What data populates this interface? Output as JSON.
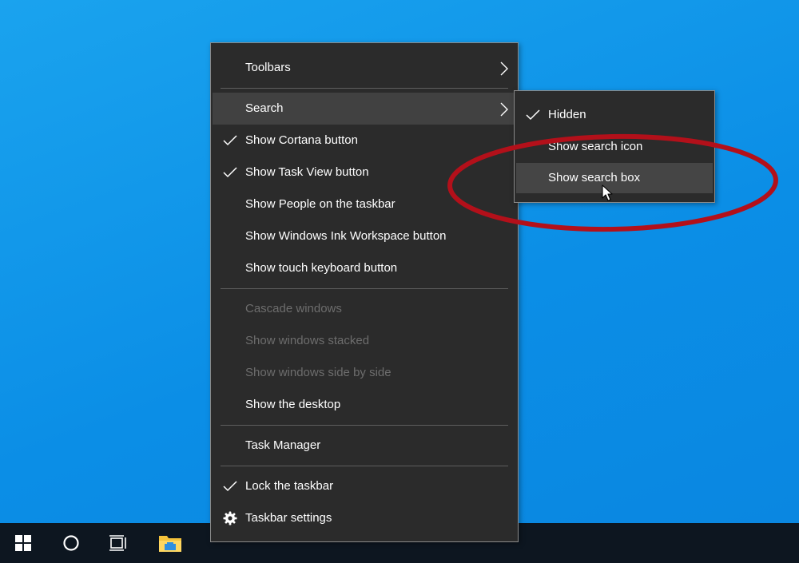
{
  "menu": {
    "toolbars": "Toolbars",
    "search": "Search",
    "show_cortana": "Show Cortana button",
    "show_task_view": "Show Task View button",
    "show_people": "Show People on the taskbar",
    "show_ink": "Show Windows Ink Workspace button",
    "show_touch_keyboard": "Show touch keyboard button",
    "cascade": "Cascade windows",
    "stacked": "Show windows stacked",
    "side_by_side": "Show windows side by side",
    "show_desktop": "Show the desktop",
    "task_manager": "Task Manager",
    "lock_taskbar": "Lock the taskbar",
    "taskbar_settings": "Taskbar settings"
  },
  "submenu": {
    "hidden": "Hidden",
    "show_search_icon": "Show search icon",
    "show_search_box": "Show search box"
  },
  "colors": {
    "menu_bg": "#2b2b2b",
    "highlight": "#414141",
    "disabled_text": "#6d6d6d",
    "annotation_ring": "#b3101a"
  },
  "icons": [
    "windows-logo-icon",
    "cortana-circle-icon",
    "task-view-icon",
    "file-explorer-icon",
    "checkmark-icon",
    "chevron-right-icon",
    "gear-icon",
    "mouse-pointer-icon"
  ]
}
